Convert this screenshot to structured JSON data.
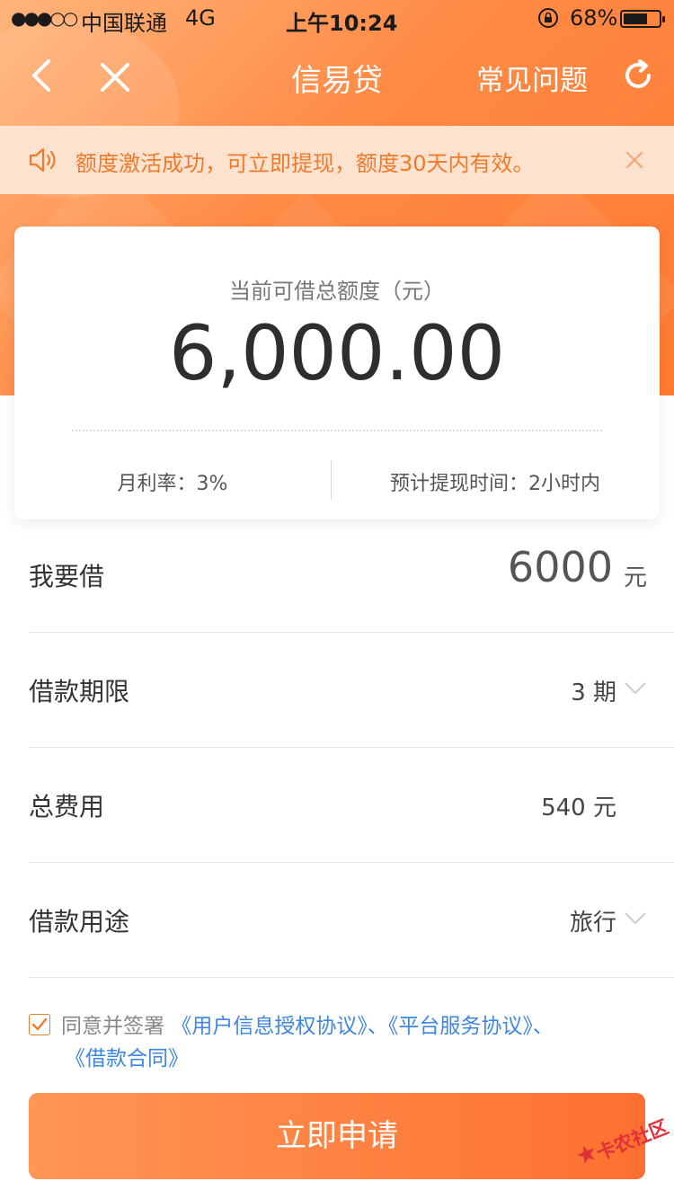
{
  "status_bar": {
    "signal": "●●●○○",
    "carrier": "中国联通",
    "network": "4G",
    "time": "上午10:24",
    "battery_percent": "68%",
    "battery_level": 0.68,
    "icons": [
      "signal-icon",
      "orientation-lock-icon",
      "battery-icon"
    ]
  },
  "nav": {
    "title": "信易贷",
    "faq_label": "常见问题",
    "icons": [
      "back-icon",
      "close-icon",
      "refresh-icon"
    ]
  },
  "notice": {
    "text": "额度激活成功，可立即提现，额度30天内有效。",
    "icons": [
      "speaker-icon",
      "close-icon"
    ]
  },
  "credit_card": {
    "label": "当前可借总额度（元）",
    "amount": "6,000.00",
    "monthly_rate": "月利率：3%",
    "eta": "预计提现时间：2小时内"
  },
  "form": {
    "amount_label": "我要借",
    "amount_value": "6000",
    "amount_unit": "元",
    "term_label": "借款期限",
    "term_value": "3 期",
    "fee_label": "总费用",
    "fee_value": "540 元",
    "purpose_label": "借款用途",
    "purpose_value": "旅行"
  },
  "agreement": {
    "checked": true,
    "prefix": "同意并签署",
    "link1": "《用户信息授权协议》",
    "sep1": "、",
    "link2": "《平台服务协议》",
    "sep2": "、",
    "link3": "《借款合同》"
  },
  "submit_label": "立即申请",
  "watermark": "卡农社区",
  "colors": {
    "brand_orange": "#ff7a30",
    "notice_bg": "#fde3cf",
    "notice_text": "#f07a2a",
    "link_blue": "#3f86e0",
    "watermark_red": "#e0303a"
  }
}
